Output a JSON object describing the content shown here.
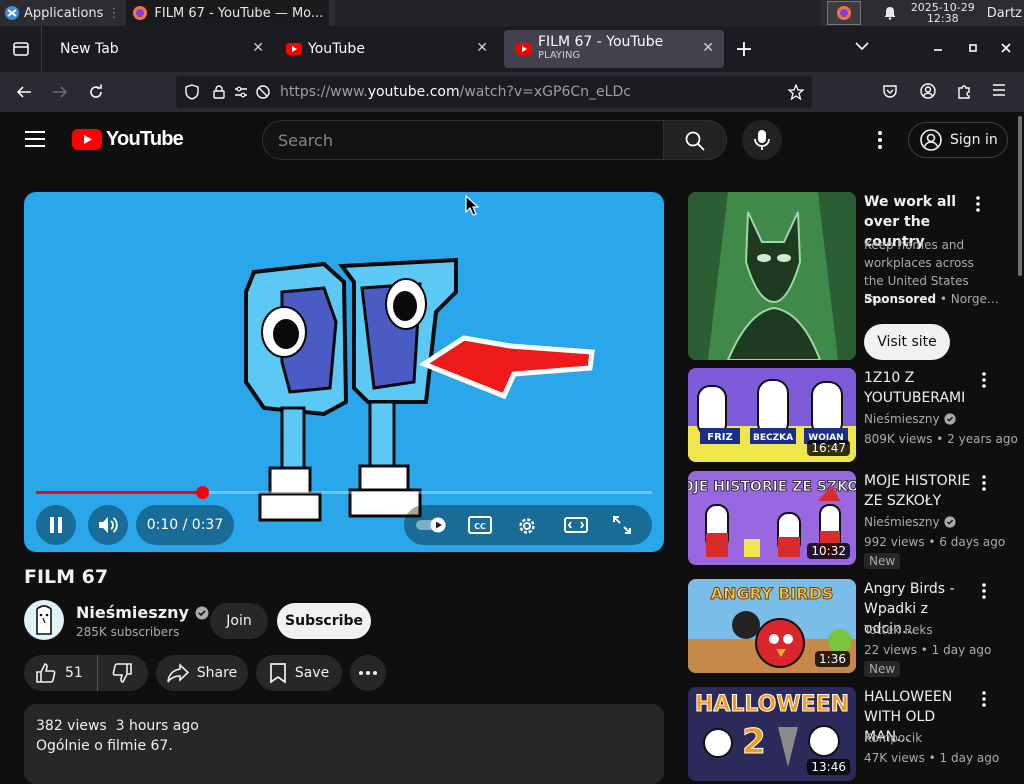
{
  "taskbar": {
    "apps_label": "Applications",
    "window_title": "FILM 67 - YouTube — Mo...",
    "date": "2025-10-29",
    "time": "12:38",
    "user": "Dartz"
  },
  "browser": {
    "tabs": [
      {
        "label": "New Tab"
      },
      {
        "label": "YouTube"
      },
      {
        "label": "FILM 67 - YouTube",
        "sublabel": "PLAYING"
      }
    ],
    "url_prefix": "https://www.",
    "url_domain": "youtube.com",
    "url_path": "/watch?v=xGP6Cn_eLDc"
  },
  "youtube": {
    "logo_text": "YouTube",
    "search_placeholder": "Search",
    "signin_label": "Sign in"
  },
  "player": {
    "time_display": "0:10 / 0:37",
    "progress": 0.27
  },
  "video": {
    "title": "FILM 67",
    "channel": "Nieśmieszny",
    "subscribers": "285K subscribers",
    "join_label": "Join",
    "subscribe_label": "Subscribe",
    "likes": "51",
    "share_label": "Share",
    "save_label": "Save",
    "views": "382 views",
    "age": "3 hours ago",
    "description": "Ogólnie o filmie 67."
  },
  "sidebar": {
    "ad": {
      "title": "We work all over the country",
      "body": "Keep homes and workplaces across the United States in…",
      "sponsored": "Sponsored",
      "advertiser": "Norge…",
      "cta": "Visit site"
    },
    "videos": [
      {
        "title": "1Z10 Z YOUTUBERAMI",
        "channel": "Nieśmieszny",
        "stats": "809K views • 2 years ago",
        "duration": "16:47",
        "new": false
      },
      {
        "title": "MOJE HISTORIE ZE SZKOŁY",
        "channel": "Nieśmieszny",
        "stats": "992 views • 6 days ago",
        "duration": "10:32",
        "new": true,
        "new_label": "New"
      },
      {
        "title": "Angry Birds - Wpadki z odcin…",
        "channel": "Tottek Reks",
        "stats": "22 views • 1 day ago",
        "duration": "1:36",
        "new": true,
        "new_label": "New"
      },
      {
        "title": "HALLOWEEN WITH OLD MAN…",
        "channel": "Kompocik",
        "stats": "47K views • 1 day ago",
        "duration": "13:46",
        "new": false
      }
    ]
  }
}
